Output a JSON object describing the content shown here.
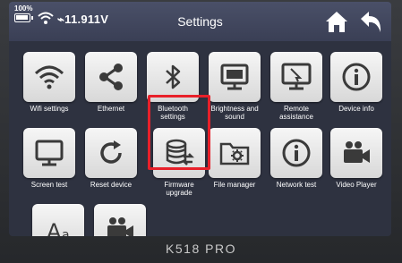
{
  "status": {
    "battery": "100%",
    "voltage": "11.911V"
  },
  "header": {
    "title": "Settings"
  },
  "apps": [
    {
      "label": "Wifi settings"
    },
    {
      "label": "Ethernet"
    },
    {
      "label": "Bluetooth\nsettings"
    },
    {
      "label": "Brightness and\nsound"
    },
    {
      "label": "Remote\nassistance"
    },
    {
      "label": "Device info"
    },
    {
      "label": "Screen test"
    },
    {
      "label": "Reset device"
    },
    {
      "label": "Firmware\nupgrade"
    },
    {
      "label": "File manager"
    },
    {
      "label": "Network test"
    },
    {
      "label": "Video Player"
    },
    {
      "label": ""
    },
    {
      "label": ""
    }
  ],
  "device": {
    "model": "K518 PRO"
  },
  "colors": {
    "highlight": "#e8202a",
    "icon": "#3a3a3a"
  }
}
